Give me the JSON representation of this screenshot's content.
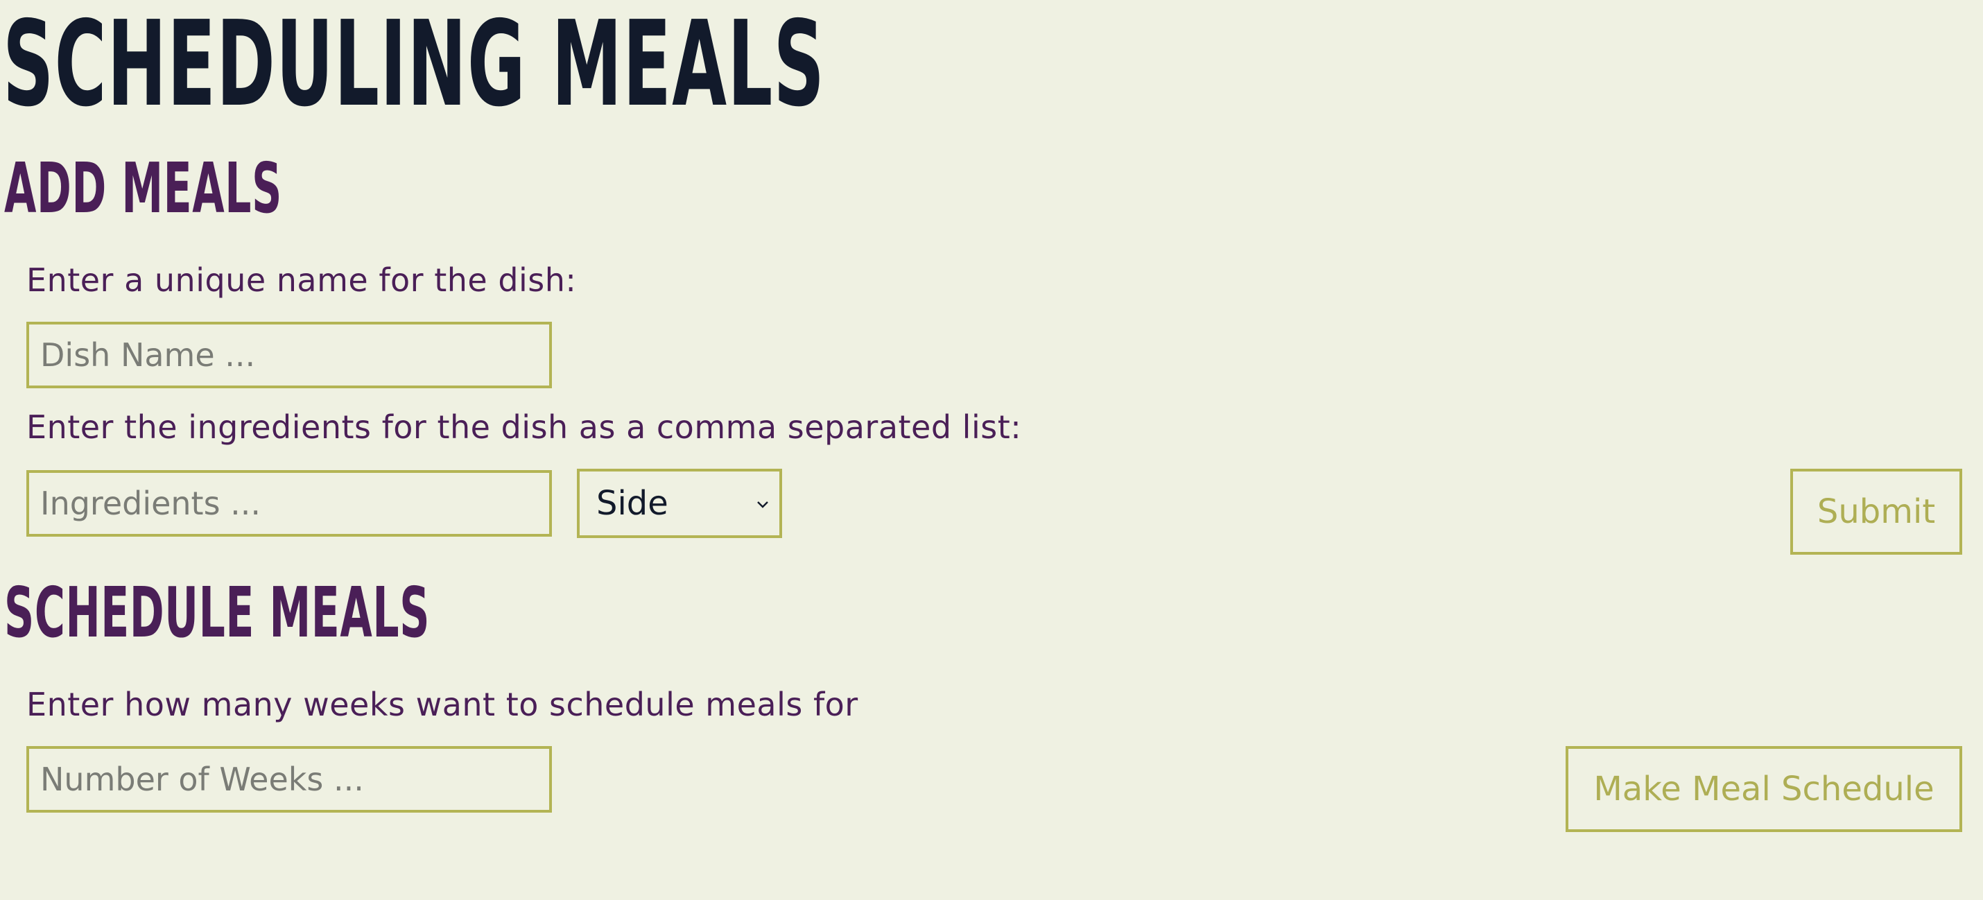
{
  "page": {
    "title": "SCHEDULING MEALS"
  },
  "add_meals": {
    "heading": "ADD MEALS",
    "dish_label": "Enter a unique name for the dish:",
    "dish_placeholder": "Dish Name ...",
    "ingredients_label": "Enter the ingredients for the dish as a comma separated list:",
    "ingredients_placeholder": "Ingredients ...",
    "course_select": {
      "selected": "Side"
    },
    "submit_label": "Submit"
  },
  "schedule_meals": {
    "heading": "SCHEDULE MEALS",
    "weeks_label": "Enter how many weeks want to schedule meals for",
    "weeks_placeholder": "Number of Weeks ...",
    "make_schedule_label": "Make Meal Schedule"
  },
  "colors": {
    "background": "#eff1e2",
    "title": "#121a2b",
    "accent_purple": "#4a1f57",
    "accent_olive": "#b3b454"
  },
  "icons": {
    "select_arrow": "chevron-down-icon"
  }
}
